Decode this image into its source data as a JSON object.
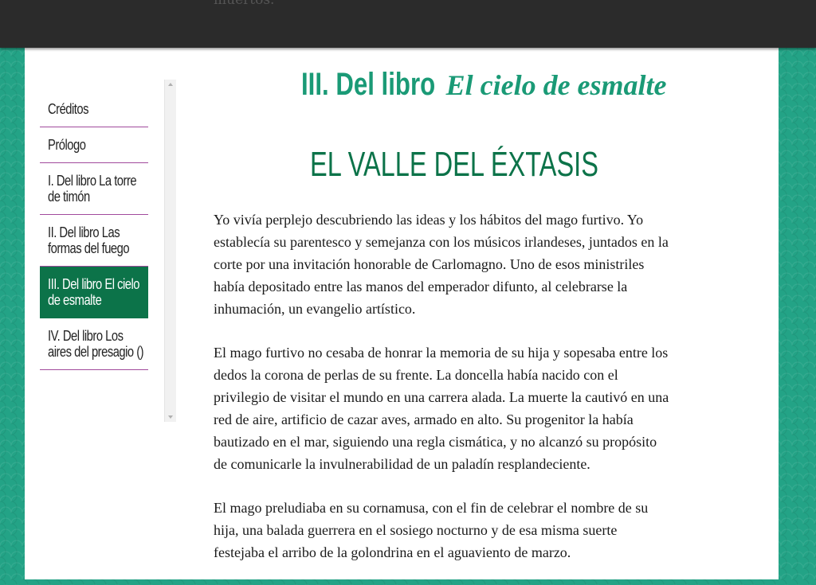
{
  "top_overlay": {
    "text": "muertos."
  },
  "sidebar": {
    "items": [
      {
        "label": "Créditos",
        "active": false
      },
      {
        "label": "Prólogo",
        "active": false
      },
      {
        "label": "I. Del libro La torre de timón",
        "active": false
      },
      {
        "label": "II. Del libro Las formas del fuego",
        "active": false
      },
      {
        "label": "III. Del libro El cielo de esmalte",
        "active": true
      },
      {
        "label": "IV. Del libro Los aires del presagio ()",
        "active": false
      }
    ]
  },
  "chapter": {
    "lead": "III. Del libro",
    "subtitle": "El cielo de esmalte"
  },
  "section_title": "EL VALLE DEL ÉXTASIS",
  "content": {
    "paragraphs": [
      "Yo vivía perplejo descubriendo las ideas y los hábitos del mago furtivo. Yo establecía su parentesco y semejanza con los músicos irlandeses, juntados en la corte por una invitación honorable de Carlomagno. Uno de esos ministriles había depositado entre las manos del emperador difunto, al celebrarse la inhumación, un evangelio artístico.",
      "El mago furtivo no cesaba de honrar la memoria de su hija y sopesaba entre los dedos la corona de perlas de su frente. La doncella había nacido con el privilegio de visitar el mundo en una carrera alada. La muerte la cautivó en una red de aire, artificio de cazar aves, armado en alto. Su progenitor la había bautizado en el mar, siguiendo una regla cismática, y no alcanzó su propósito de comunicarle la invulnerabilidad de un paladín resplandeciente.",
      "El mago preludiaba en su cornamusa, con el fin de celebrar el nombre de su hija, una balada guerrera en el sosiego nocturno y de esa misma suerte festejaba el arribo de la golondrina en el aguaviento de marzo."
    ]
  },
  "colors": {
    "accent": "#1a9a76",
    "title": "#0c7349",
    "active_bg": "#0c7349",
    "divider": "#a14a9c",
    "backdrop": "#23a386"
  }
}
